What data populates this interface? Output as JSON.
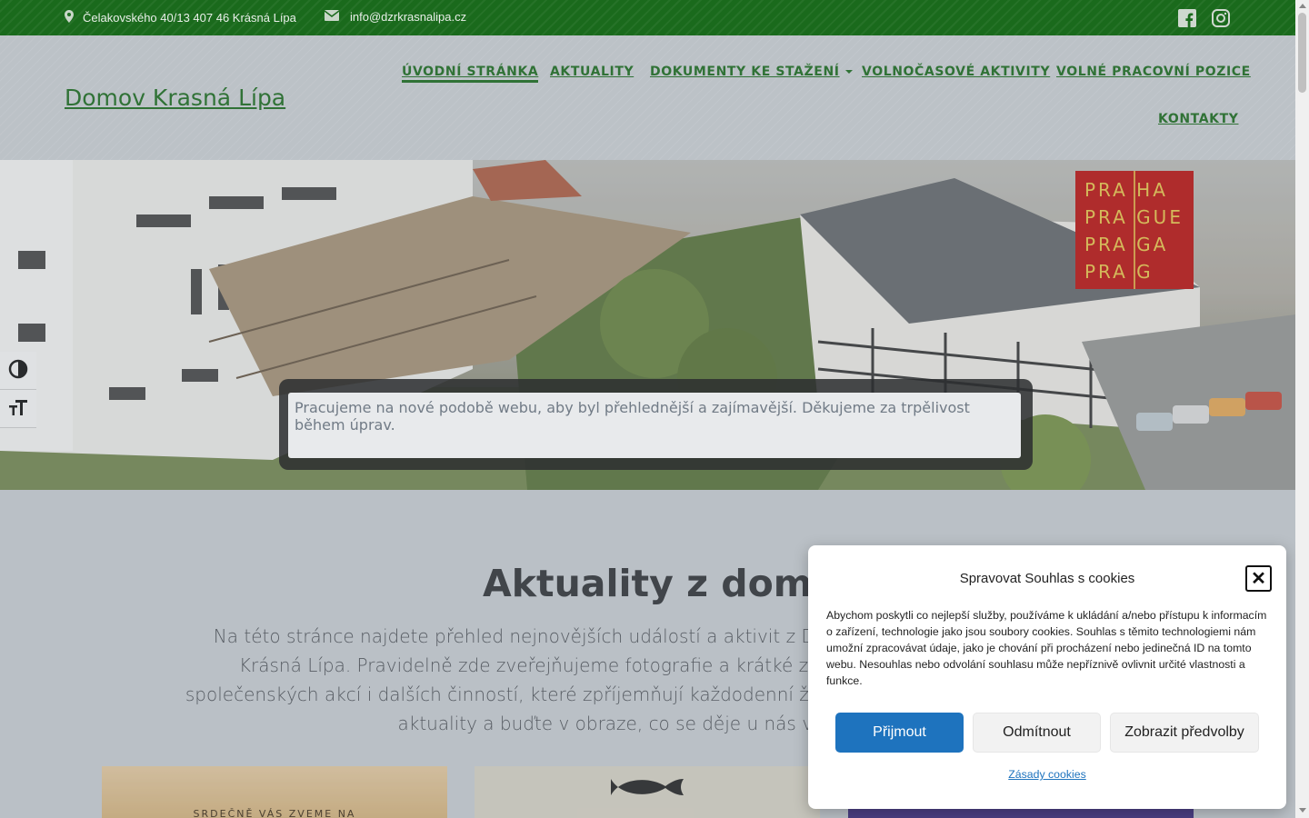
{
  "topbar": {
    "address": "Čelakovského 40/13 407 46 Krásná Lípa",
    "email": "info@dzrkrasnalipa.cz",
    "social": [
      "facebook-icon",
      "instagram-icon"
    ]
  },
  "header": {
    "site_title": "Domov Krasná Lípa",
    "nav": [
      {
        "label": "ÚVODNÍ STRÁNKA",
        "active": true
      },
      {
        "label": "AKTUALITY"
      },
      {
        "label": "DOKUMENTY KE STAŽENÍ",
        "has_dropdown": true
      },
      {
        "label": "VOLNOČASOVÉ AKTIVITY"
      },
      {
        "label": "VOLNÉ PRACOVNÍ POZICE"
      },
      {
        "label": "KONTAKTY"
      }
    ]
  },
  "hero": {
    "notice": "Pracujeme na nové podobě webu, aby byl přehlednější a zajímavější. Děkujeme za trpělivost během úprav.",
    "logo_lines": [
      "PRA HA",
      "PRA GUE",
      "PRA GA",
      "PRA G"
    ]
  },
  "section": {
    "title": "Aktuality z domova",
    "text": "Na této stránce najdete přehled nejnovějších událostí a aktivit z Domova se zvláštním režimem Krásná Lípa. Pravidelně zde zveřejňujeme fotografie a krátké zprávy z výletů, kulturních a společenských akcí i dalších činností, které zpříjemňují každodenní život našich klientů. Sledujte naše aktuality a buďte v obraze, co se děje u nás v domova.",
    "card1_text": "SRDEČNĚ VÁS ZVEME NA"
  },
  "cookie": {
    "title": "Spravovat Souhlas s cookies",
    "body": "Abychom poskytli co nejlepší služby, používáme k ukládání a/nebo přístupu k informacím o zařízení, technologie jako jsou soubory cookies. Souhlas s těmito technologiemi nám umožní zpracovávat údaje, jako je chování při procházení nebo jedinečná ID na tomto webu. Nesouhlas nebo odvolání souhlasu může nepříznivě ovlivnit určité vlastnosti a funkce.",
    "accept": "Přijmout",
    "deny": "Odmítnout",
    "preferences": "Zobrazit předvolby",
    "policy": "Zásady cookies"
  },
  "colors": {
    "brand_green": "#1a6a1c",
    "accept_blue": "#1e73be",
    "praha_red": "#b8120f"
  }
}
